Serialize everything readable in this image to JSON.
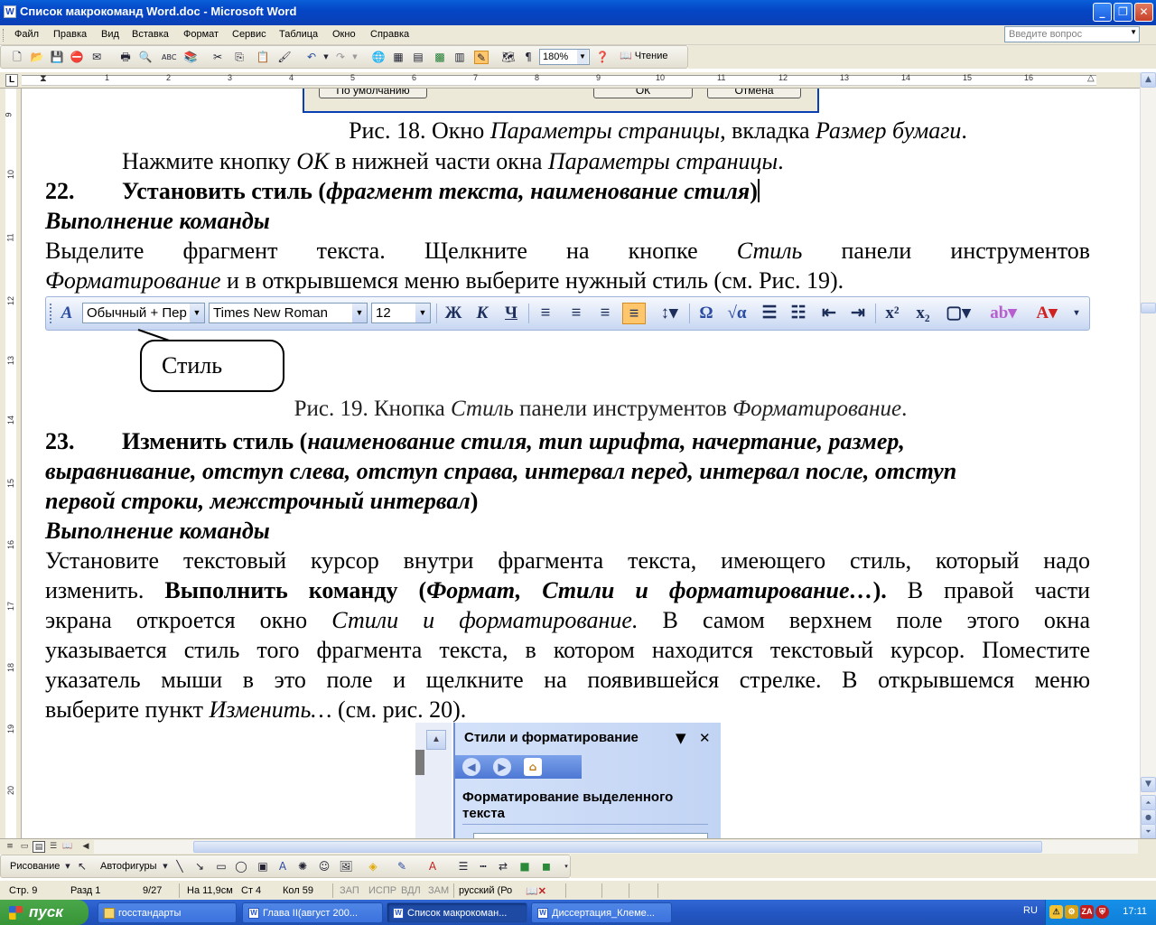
{
  "window": {
    "title": "Список макрокоманд Word.doc - Microsoft Word",
    "app_icon": "W"
  },
  "menu": [
    "Файл",
    "Правка",
    "Вид",
    "Вставка",
    "Формат",
    "Сервис",
    "Таблица",
    "Окно",
    "Справка"
  ],
  "help_search": {
    "placeholder": "Введите вопрос"
  },
  "toolbar": {
    "zoom": "180%",
    "read_label": "Чтение"
  },
  "ruler": {
    "ticks": [
      "1",
      "2",
      "3",
      "4",
      "5",
      "6",
      "7",
      "8",
      "9",
      "10",
      "11",
      "12",
      "13",
      "14",
      "15",
      "16"
    ]
  },
  "vruler": {
    "ticks": [
      "9",
      "10",
      "11",
      "12",
      "13",
      "14",
      "15",
      "16",
      "17",
      "18",
      "19",
      "20"
    ]
  },
  "document": {
    "fig18_buttons": [
      "По умолчанию",
      "ОК",
      "Отмена"
    ],
    "fig18_caption": {
      "a": "Рис. 18. Окно ",
      "b": "Параметры страницы",
      "c": ", вкладка ",
      "d": "Размер бумаги",
      "e": "."
    },
    "line_ok": {
      "a": "Нажмите кнопку ",
      "b": "OK",
      "c": " в нижней части окна ",
      "d": "Параметры страницы",
      "e": "."
    },
    "item22": {
      "num": "22.",
      "a": "Установить стиль (",
      "b": "фрагмент текста, наименование стиля",
      "c": ")"
    },
    "exec1": "Выполнение команды",
    "p1_line1": {
      "a": "Выделите фрагмент текста. Щелкните на кнопке ",
      "b": "Стиль",
      "c": " панели инструментов"
    },
    "p1_line2": {
      "a": "Форматирование",
      "b": " и в открывшемся меню выберите нужный стиль (см. Рис. 19)."
    },
    "fmtbar": {
      "style": "Обычный + Пер",
      "font": "Times New Roman",
      "size": "12"
    },
    "callout": "Стиль",
    "fig19_caption": {
      "a": "Рис. 19. Кнопка ",
      "b": "Стиль",
      "c": " панели инструментов ",
      "d": "Форматирование",
      "e": "."
    },
    "item23": {
      "num": "23.",
      "a": "Изменить стиль (",
      "line1_i": "наименование стиля, тип шрифта, начертание, размер,",
      "line2_i": "выравнивание, отступ слева, отступ справа, интервал перед, интервал после, отступ",
      "line3_i": "первой строки, межстрочный интервал",
      "line3_c": ")"
    },
    "exec2": "Выполнение команды",
    "p2": {
      "l1": "Установите текстовый курсор внутри фрагмента текста, имеющего стиль, который надо",
      "l2_a": "изменить. ",
      "l2_b": "Выполнить команду (",
      "l2_c": "Формат, Стили и форматирование…",
      "l2_d": ").",
      "l2_e": " В правой части",
      "l3_a": "экрана откроется окно ",
      "l3_b": "Стили и форматирование.",
      "l3_c": " В самом верхнем поле этого окна",
      "l4": "указывается стиль того фрагмента текста, в котором находится текстовый курсор. Поместите",
      "l5": "указатель мыши в это поле и щелкните на появившейся стрелке. В открывшемся меню",
      "l6_a": "выберите пункт ",
      "l6_b": "Изменить…",
      "l6_c": " (см. рис. 20)."
    },
    "pane": {
      "title": "Стили и форматирование",
      "section": "Форматирование выделенного текста"
    }
  },
  "drawbar": {
    "draw": "Рисование",
    "autoshapes": "Автофигуры"
  },
  "status": {
    "page": "Стр. 9",
    "section": "Разд 1",
    "pages": "9/27",
    "at": "На 11,9см",
    "line": "Ст 4",
    "col": "Кол 59",
    "rec": "ЗАП",
    "trk": "ИСПР",
    "ext": "ВДЛ",
    "ovr": "ЗАМ",
    "lang": "русский (Ро"
  },
  "taskbar": {
    "start": "пуск",
    "tasks": [
      "госстандарты",
      "Глава II(август 200...",
      "Список макрокоман...",
      "Диссертация_Клеме..."
    ],
    "lang": "RU",
    "clock": "17:11"
  },
  "colors": {
    "titlebar": "#0446c6",
    "taskbar": "#2457c4",
    "start": "#379437",
    "tray": "#0f7fd8"
  }
}
